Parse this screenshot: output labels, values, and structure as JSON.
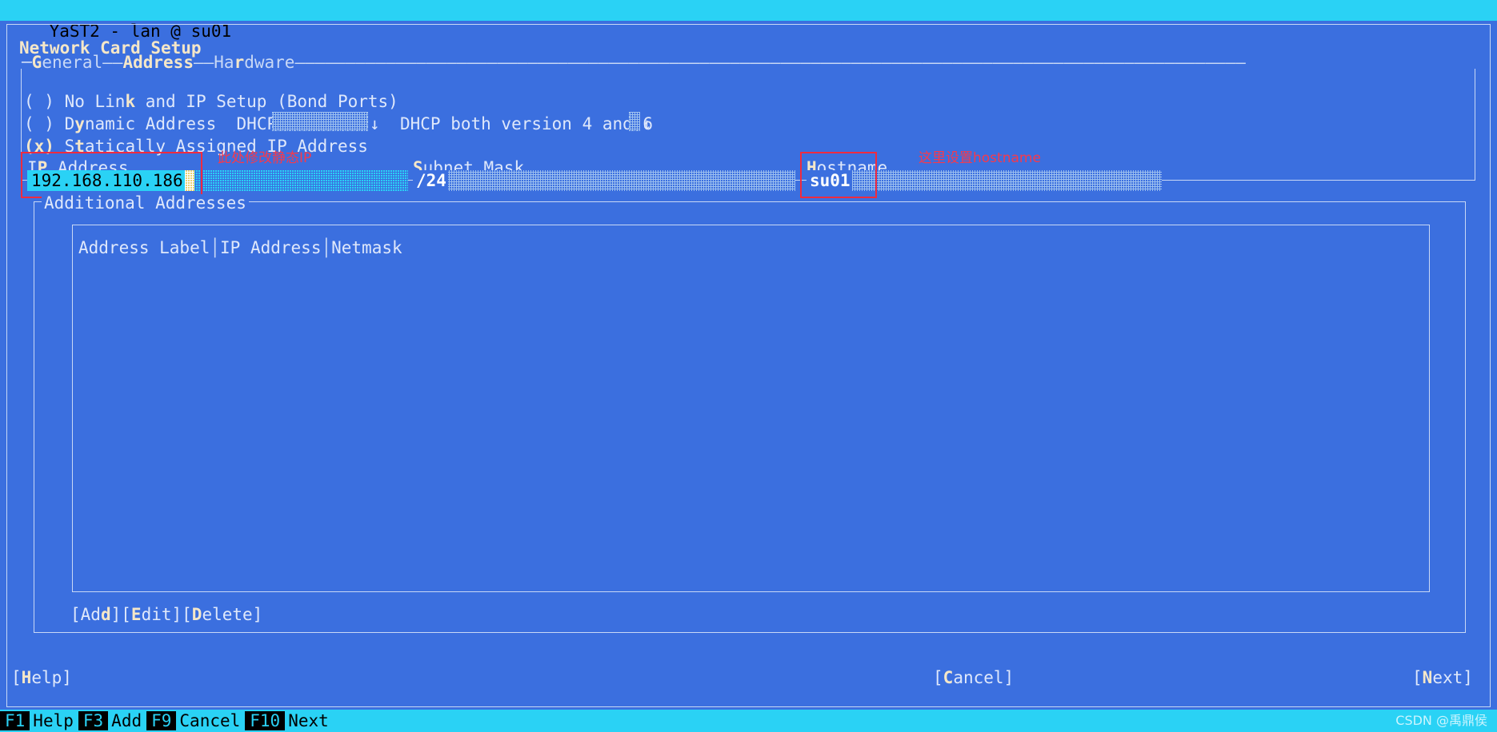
{
  "window": {
    "title": "YaST2 - lan @ su01",
    "titlebar_bg": "#2ad2f5",
    "screen_bg": "#3b6fdf"
  },
  "dialog": {
    "heading": "Network Card Setup"
  },
  "tabs": {
    "items": [
      {
        "label": "General",
        "hotkey": "G",
        "active": false
      },
      {
        "label": "Address",
        "hotkey": "A",
        "active": true
      },
      {
        "label": "Hardware",
        "hotkey": "r",
        "active": false
      }
    ],
    "general_pre": "",
    "general_hk": "G",
    "general_rest": "eneral",
    "dash1": "——",
    "address_label": "Address",
    "dash2": "——",
    "hardware_pre": "Ha",
    "hardware_hk": "r",
    "hardware_rest": "dware",
    "dash3": "——————————————————————————————————————————————————————————————————————————————————————————————"
  },
  "radios": [
    {
      "mark": "( ) ",
      "pre": "No Lin",
      "hotkey": "k",
      "post": " and IP Setup (Bond Ports)",
      "selected": false
    },
    {
      "mark": "( ) ",
      "pre": "D",
      "hotkey": "y",
      "post": "namic Address  DHCP",
      "selected": false
    },
    {
      "mark": "(x) ",
      "pre": "S",
      "hotkey": "t",
      "post": "atically Assigned IP Address",
      "selected": true
    }
  ],
  "dhcp": {
    "version_combo_value": "",
    "version_combo_arrow": "↓",
    "mode_label": "DHCP both version 4 and 6",
    "mode_arrow": "↓"
  },
  "fields": {
    "ip": {
      "label_pre": "I",
      "label_hotkey": "P",
      "label_post": " Address",
      "value": "192.168.110.186",
      "focused": true
    },
    "subnet": {
      "label_pre": "",
      "label_hotkey": "S",
      "label_post": "ubnet Mask",
      "value": "/24",
      "focused": false
    },
    "hostname": {
      "label_pre": "",
      "label_hotkey": "H",
      "label_post": "ostname",
      "value": "su01",
      "focused": false
    }
  },
  "annotations": [
    {
      "text": "此处修改静态IP",
      "color": "#f8394b"
    },
    {
      "text": "这里设置hostname",
      "color": "#f8394b"
    }
  ],
  "additional": {
    "group_label": "Additional Addresses",
    "columns": [
      "Address Label",
      "IP Address",
      "Netmask"
    ],
    "header_line": "Address Label│IP Address│Netmask",
    "rows": [],
    "buttons": [
      {
        "pre": "[Ad",
        "hotkey": "d",
        "post": "]"
      },
      {
        "pre": "[",
        "hotkey": "E",
        "post": "dit]"
      },
      {
        "pre": "[",
        "hotkey": "D",
        "post": "elete]"
      }
    ],
    "buttons_text": "[Add][Edit][Delete]"
  },
  "bottom_buttons": {
    "help": {
      "pre": "[",
      "hotkey": "H",
      "post": "elp]"
    },
    "cancel": {
      "pre": "[",
      "hotkey": "C",
      "post": "ancel]"
    },
    "next": {
      "pre": "[",
      "hotkey": "N",
      "post": "ext]"
    }
  },
  "function_keys": [
    {
      "key": "F1",
      "label": "Help"
    },
    {
      "key": "F3",
      "label": "Add"
    },
    {
      "key": "F9",
      "label": "Cancel"
    },
    {
      "key": "F10",
      "label": "Next"
    }
  ],
  "watermark": "CSDN @禹鼎侯"
}
